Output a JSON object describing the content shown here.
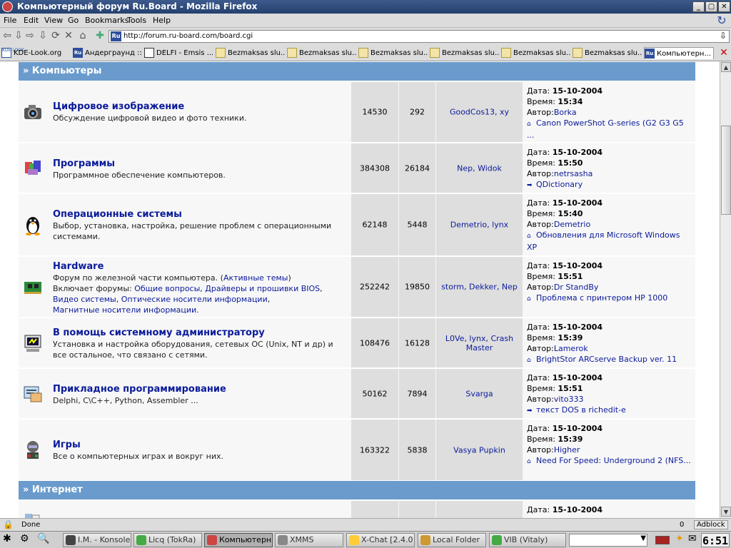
{
  "window": {
    "title": "Компьютерный форум Ru.Board - Mozilla Firefox"
  },
  "menu": [
    "File",
    "Edit",
    "View",
    "Go",
    "Bookmarks",
    "Tools",
    "Help"
  ],
  "url": "http://forum.ru-board.com/board.cgi",
  "bookmarks": [
    "KDE-Look.org",
    "Андерграунд ::...",
    "DELFI - Emsis ...",
    "Bezmaksas slu...",
    "Bezmaksas slu...",
    "Bezmaksas slu...",
    "Bezmaksas slu...",
    "Bezmaksas slu...",
    "Bezmaksas slu...",
    "Компьютерн..."
  ],
  "categories": {
    "computers": "» Компьютеры",
    "internet": "» Интернет"
  },
  "forums": [
    {
      "title": "Цифровое изображение",
      "desc": "Обсуждение цифровой видео и фото техники.",
      "topics": "14530",
      "posts": "292",
      "mods": "GoodCos13, xy",
      "date_label": "Дата:",
      "date": "15-10-2004",
      "time_label": "Время:",
      "time": "15:34",
      "author_label": "Автор:",
      "author": "Borka",
      "last": "Canon PowerShot G-series (G2 G3 G5 ..."
    },
    {
      "title": "Программы",
      "desc": "Программное обеспечение компьютеров.",
      "topics": "384308",
      "posts": "26184",
      "mods": "Nep, Widok",
      "date_label": "Дата:",
      "date": "15-10-2004",
      "time_label": "Время:",
      "time": "15:50",
      "author_label": "Автор:",
      "author": "netrsasha",
      "last": "QDictionary"
    },
    {
      "title": "Операционные системы",
      "desc": "Выбор, установка, настройка, решение проблем с операционными системами.",
      "topics": "62148",
      "posts": "5448",
      "mods": "Demetrio, lynx",
      "date_label": "Дата:",
      "date": "15-10-2004",
      "time_label": "Время:",
      "time": "15:40",
      "author_label": "Автор:",
      "author": "Demetrio",
      "last": "Обновления для Microsoft Windows XP"
    },
    {
      "title": "Hardware",
      "desc1": "Форум по железной части компьютера. (",
      "desc1_link": "Активные темы",
      "desc1_end": ")",
      "desc2": "Включает форумы: ",
      "subs": [
        "Общие вопросы",
        "Драйверы и прошивки BIOS",
        "Видео системы",
        "Оптические носители информации",
        "Магнитные носители информации."
      ],
      "topics": "252242",
      "posts": "19850",
      "mods": "storm, Dekker, Nep",
      "date_label": "Дата:",
      "date": "15-10-2004",
      "time_label": "Время:",
      "time": "15:51",
      "author_label": "Автор:",
      "author": "Dr StandBy",
      "last": "Проблема с принтером HP 1000"
    },
    {
      "title": "В помощь системному администратору",
      "desc": "Установка и настройка оборудования, сетевых ОС (Unix, NT и др) и все остальное, что связано с сетями.",
      "topics": "108476",
      "posts": "16128",
      "mods": "L0Ve, lynx, Crash Master",
      "date_label": "Дата:",
      "date": "15-10-2004",
      "time_label": "Время:",
      "time": "15:39",
      "author_label": "Автор:",
      "author": "Lamerok",
      "last": "BrightStor ARCserve Backup ver. 11"
    },
    {
      "title": "Прикладное программирование",
      "desc": "Delphi, C\\C++, Python, Assembler ...",
      "topics": "50162",
      "posts": "7894",
      "mods": "Svarga",
      "date_label": "Дата:",
      "date": "15-10-2004",
      "time_label": "Время:",
      "time": "15:51",
      "author_label": "Автор:",
      "author": "vito333",
      "last": "текст DOS в richedit-e"
    },
    {
      "title": "Игры",
      "desc": "Все о компьютерных играх и вокруг них.",
      "topics": "163322",
      "posts": "5838",
      "mods": "Vasya Pupkin",
      "date_label": "Дата:",
      "date": "15-10-2004",
      "time_label": "Время:",
      "time": "15:39",
      "author_label": "Автор:",
      "author": "Higher",
      "last": "Need For Speed: Underground 2 (NFS..."
    }
  ],
  "partial_row": {
    "date_label": "Дата:",
    "date": "15-10-2004"
  },
  "status": {
    "text": "Done",
    "count": "0",
    "adblock": "Adblock"
  },
  "taskbar": [
    "I.M. - Konsole",
    "Licq (TokRa)",
    "Компьютерн",
    "XMMS",
    "X-Chat [2.4.0",
    "Local Folder",
    "VIB (Vitaly)"
  ],
  "clock": "6:51"
}
